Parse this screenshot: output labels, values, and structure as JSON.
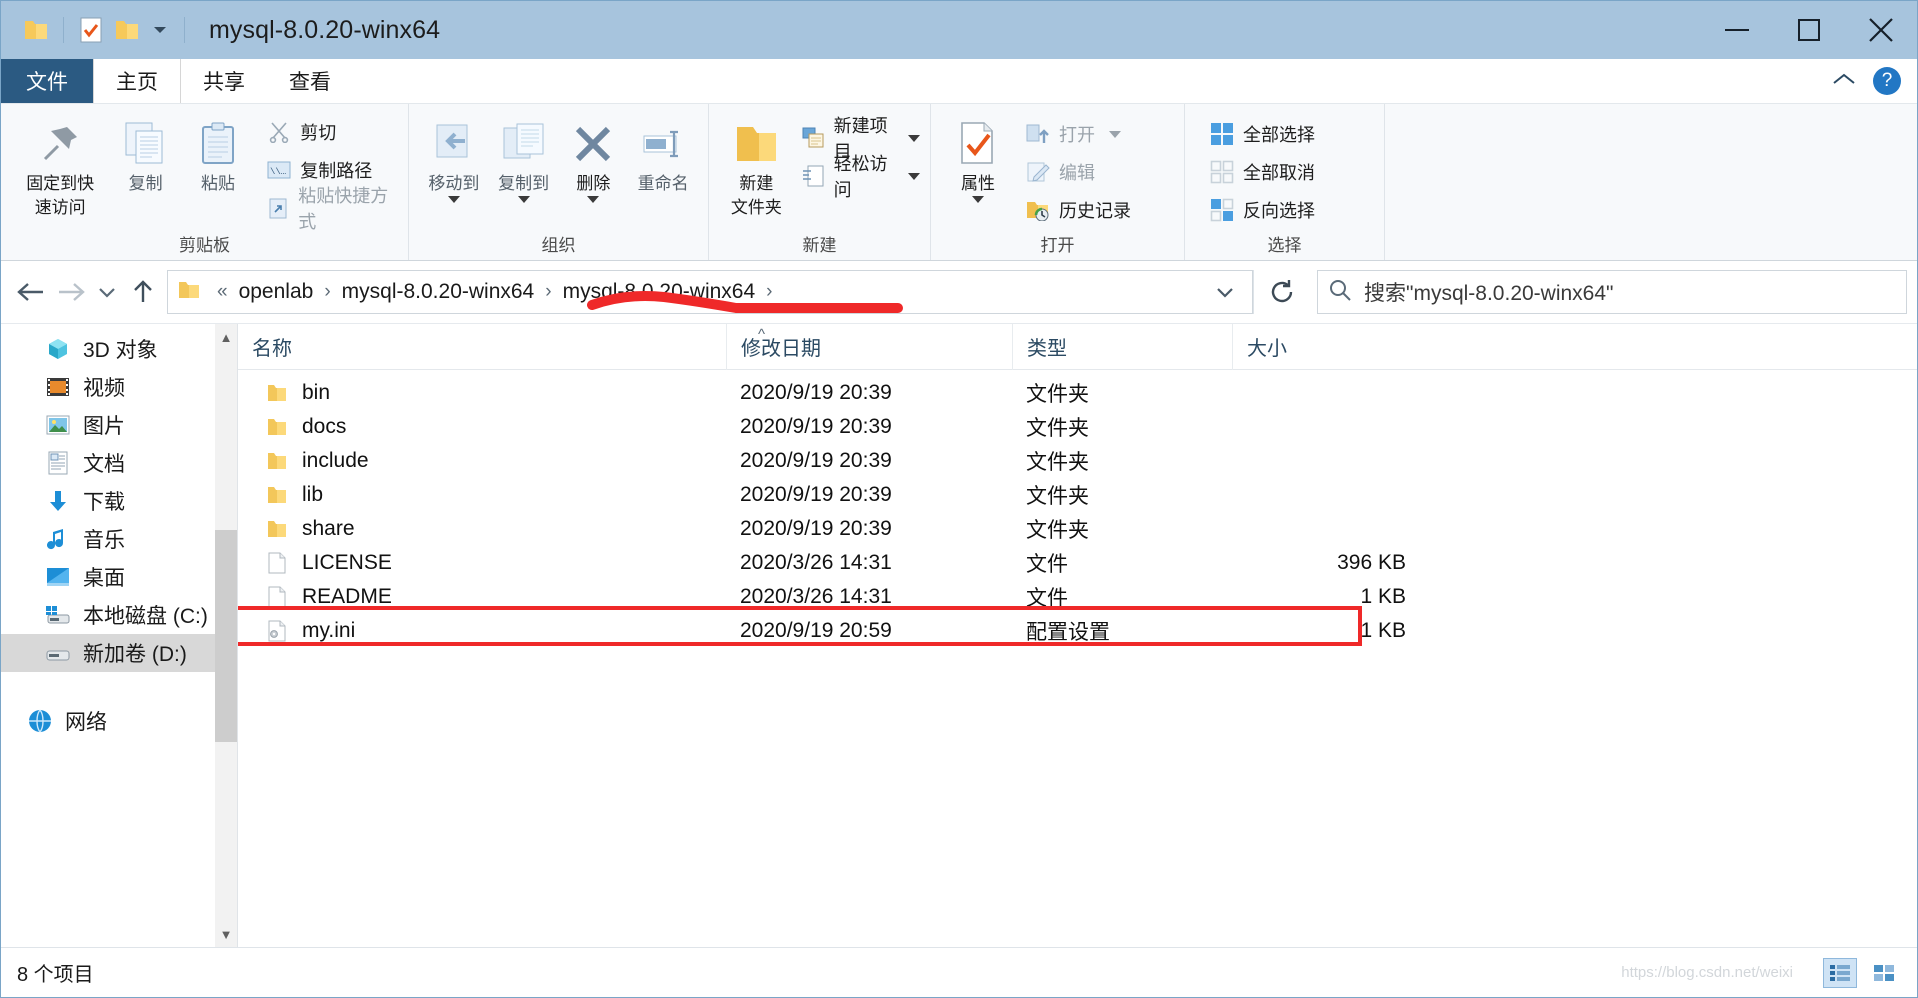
{
  "window": {
    "title": "mysql-8.0.20-winx64",
    "minimize_label": "—",
    "maximize_label": "□",
    "close_label": "✕"
  },
  "quick_access": {
    "folder_icon": "folder-icon",
    "properties_icon": "properties-checkmark-icon",
    "newfolder_icon": "folder-icon",
    "customize_caret": "chevron-down-icon"
  },
  "tabs": [
    {
      "label": "文件",
      "name": "tab-file"
    },
    {
      "label": "主页",
      "name": "tab-home"
    },
    {
      "label": "共享",
      "name": "tab-share"
    },
    {
      "label": "查看",
      "name": "tab-view"
    }
  ],
  "ribbon": {
    "collapse_icon": "chevron-up-icon",
    "help_icon": "?",
    "groups": [
      {
        "label": "剪贴板",
        "big": [
          {
            "label": "固定到快\n速访问",
            "line1": "固定到快",
            "line2": "速访问",
            "icon": "pin-icon"
          },
          {
            "label": "复制",
            "icon": "copy-icon"
          },
          {
            "label": "粘贴",
            "icon": "paste-icon"
          }
        ],
        "small": [
          {
            "label": "剪切",
            "icon": "scissors-icon",
            "disabled": false
          },
          {
            "label": "复制路径",
            "icon": "copy-path-icon",
            "disabled": false
          },
          {
            "label": "粘贴快捷方式",
            "icon": "paste-shortcut-icon",
            "disabled": true
          }
        ]
      },
      {
        "label": "组织",
        "big": [
          {
            "label": "移动到",
            "icon": "move-to-icon",
            "caret": true
          },
          {
            "label": "复制到",
            "icon": "copy-to-icon",
            "caret": true
          },
          {
            "label": "删除",
            "icon": "delete-x-icon",
            "caret": true
          },
          {
            "label": "重命名",
            "icon": "rename-icon"
          }
        ],
        "small": []
      },
      {
        "label": "新建",
        "big": [
          {
            "label": "新建\n文件夹",
            "line1": "新建",
            "line2": "文件夹",
            "icon": "new-folder-icon"
          }
        ],
        "small": [
          {
            "label": "新建项目",
            "icon": "new-item-icon",
            "caret": true
          },
          {
            "label": "轻松访问",
            "icon": "easy-access-icon",
            "caret": true
          }
        ]
      },
      {
        "label": "打开",
        "big": [
          {
            "label": "属性",
            "icon": "properties-checkmark-icon",
            "caret": true
          }
        ],
        "small": [
          {
            "label": "打开",
            "icon": "open-icon",
            "caret": true,
            "disabled": true
          },
          {
            "label": "编辑",
            "icon": "edit-icon",
            "disabled": true
          },
          {
            "label": "历史记录",
            "icon": "history-icon",
            "disabled": false
          }
        ]
      },
      {
        "label": "选择",
        "big": [],
        "small": [
          {
            "label": "全部选择",
            "icon": "select-all-icon"
          },
          {
            "label": "全部取消",
            "icon": "select-none-icon"
          },
          {
            "label": "反向选择",
            "icon": "invert-selection-icon"
          }
        ]
      }
    ]
  },
  "addressbar": {
    "back_icon": "arrow-left-icon",
    "forward_icon": "arrow-right-icon",
    "recent_icon": "chevron-down-icon",
    "up_icon": "arrow-up-icon",
    "folder_icon": "folder-icon",
    "overflow": "«",
    "crumbs": [
      "openlab",
      "mysql-8.0.20-winx64",
      "mysql-8.0.20-winx64"
    ],
    "separator": "›",
    "history_caret": "chevron-down-icon",
    "refresh_icon": "refresh-icon",
    "search_icon": "search-icon",
    "search_placeholder": "搜索\"mysql-8.0.20-winx64\"",
    "annotation_color": "#ef2929"
  },
  "sidebar": {
    "items": [
      {
        "label": "3D 对象",
        "icon": "3d-object-icon",
        "selected": false
      },
      {
        "label": "视频",
        "icon": "video-icon",
        "selected": false
      },
      {
        "label": "图片",
        "icon": "picture-icon",
        "selected": false
      },
      {
        "label": "文档",
        "icon": "document-icon",
        "selected": false
      },
      {
        "label": "下载",
        "icon": "download-icon",
        "selected": false
      },
      {
        "label": "音乐",
        "icon": "music-icon",
        "selected": false
      },
      {
        "label": "桌面",
        "icon": "desktop-icon",
        "selected": false
      },
      {
        "label": "本地磁盘 (C:)",
        "icon": "local-disk-icon",
        "selected": false
      },
      {
        "label": "新加卷 (D:)",
        "icon": "drive-icon",
        "selected": true
      }
    ],
    "network": {
      "label": "网络",
      "icon": "network-icon"
    },
    "scroll_up": "▲",
    "scroll_down": "▼"
  },
  "filelist": {
    "columns": [
      "名称",
      "修改日期",
      "类型",
      "大小"
    ],
    "sort_indicator": "^",
    "rows": [
      {
        "name": "bin",
        "date": "2020/9/19 20:39",
        "type": "文件夹",
        "size": "",
        "icon": "folder-icon",
        "highlighted": false
      },
      {
        "name": "docs",
        "date": "2020/9/19 20:39",
        "type": "文件夹",
        "size": "",
        "icon": "folder-icon",
        "highlighted": false
      },
      {
        "name": "include",
        "date": "2020/9/19 20:39",
        "type": "文件夹",
        "size": "",
        "icon": "folder-icon",
        "highlighted": false
      },
      {
        "name": "lib",
        "date": "2020/9/19 20:39",
        "type": "文件夹",
        "size": "",
        "icon": "folder-icon",
        "highlighted": false
      },
      {
        "name": "share",
        "date": "2020/9/19 20:39",
        "type": "文件夹",
        "size": "",
        "icon": "folder-icon",
        "highlighted": false
      },
      {
        "name": "LICENSE",
        "date": "2020/3/26 14:31",
        "type": "文件",
        "size": "396 KB",
        "icon": "file-icon",
        "highlighted": false
      },
      {
        "name": "README",
        "date": "2020/3/26 14:31",
        "type": "文件",
        "size": "1 KB",
        "icon": "file-icon",
        "highlighted": false
      },
      {
        "name": "my.ini",
        "date": "2020/9/19 20:59",
        "type": "配置设置",
        "size": "1 KB",
        "icon": "ini-file-icon",
        "highlighted": true
      }
    ]
  },
  "statusbar": {
    "count_text": "8 个项目",
    "watermark": "https://blog.csdn.net/weixi",
    "details_view_icon": "details-view-icon",
    "large_icons_view_icon": "large-icons-view-icon"
  }
}
